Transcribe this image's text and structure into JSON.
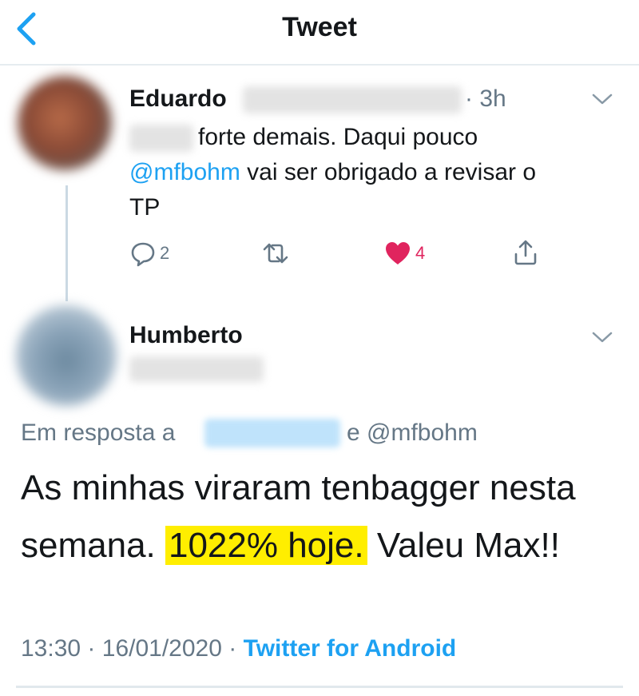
{
  "header": {
    "title": "Tweet",
    "back_icon": "chevron-left-icon"
  },
  "tweet1": {
    "author": "Eduardo",
    "separator": "·",
    "time": "3h",
    "text_after_blur": "forte demais. Daqui pouco",
    "mention": "@mfbohm",
    "text_line2": " vai ser obrigado a revisar o",
    "text_line3": "TP",
    "actions": {
      "replies": "2",
      "likes": "4"
    }
  },
  "tweet2": {
    "author": "Humberto",
    "reply_prefix": "Em resposta a",
    "reply_and": "e @mfbohm",
    "text_line1": "As minhas viraram tenbagger nesta",
    "text_line2_pre": "semana. ",
    "text_highlight": "1022% hoje.",
    "text_line2_post": " Valeu Max!!",
    "highlight_color": "#ffee00",
    "time": "13:30",
    "sep1": "·",
    "date": "16/01/2020",
    "sep2": "·",
    "source": "Twitter for Android"
  },
  "colors": {
    "accent": "#1da1f2",
    "like": "#e0245e",
    "muted": "#657786"
  }
}
